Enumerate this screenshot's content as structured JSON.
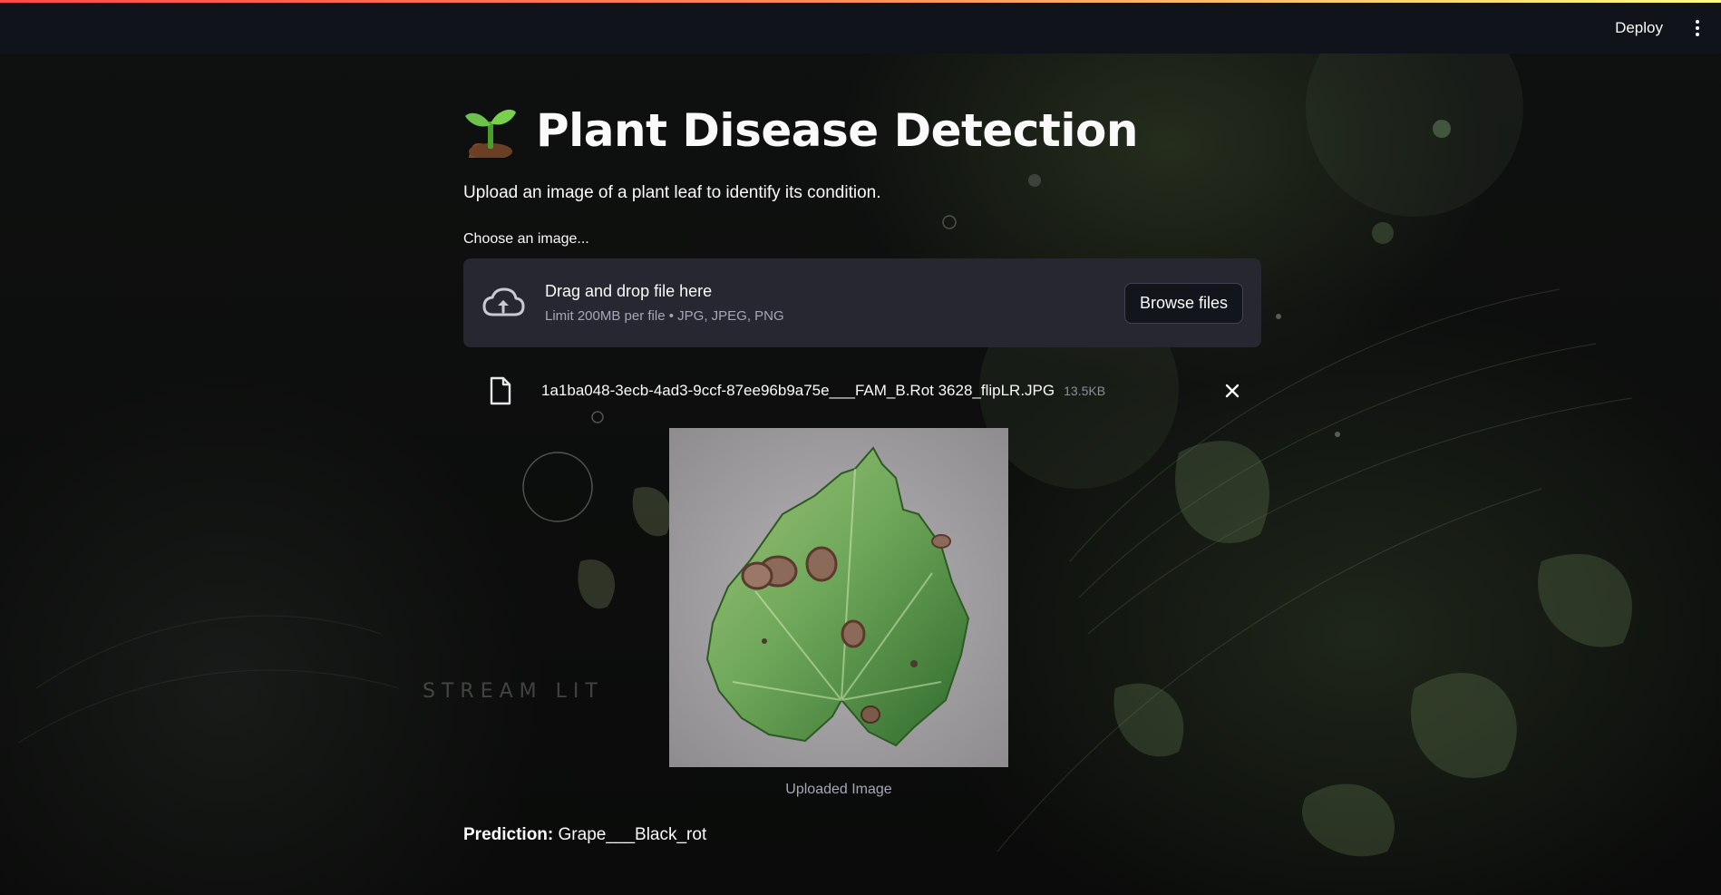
{
  "header": {
    "deploy_label": "Deploy",
    "menu_icon": "more-vertical-icon"
  },
  "main": {
    "title": "Plant Disease Detection",
    "title_icon": "sprout-icon",
    "subtitle": "Upload an image of a plant leaf to identify its condition.",
    "uploader": {
      "label": "Choose an image...",
      "drop_title": "Drag and drop file here",
      "limit_text": "Limit 200MB per file • JPG, JPEG, PNG",
      "browse_label": "Browse files",
      "upload_icon": "cloud-upload-icon"
    },
    "file": {
      "name": "1a1ba048-3ecb-4ad3-9ccf-87ee96b9a75e___FAM_B.Rot 3628_flipLR.JPG",
      "size": "13.5KB",
      "file_icon": "file-icon",
      "remove_icon": "close-icon"
    },
    "image": {
      "caption": "Uploaded Image"
    },
    "prediction": {
      "label": "Prediction:",
      "value": "Grape___Black_rot"
    }
  },
  "background": {
    "watermark": "STREAM LIT"
  },
  "colors": {
    "header_bg": "#101319",
    "dropzone_bg": "#262730",
    "accent_start": "#ff4b4b",
    "accent_end": "#fffd80",
    "text": "#fafafa",
    "muted_text": "#a3a8b8"
  }
}
